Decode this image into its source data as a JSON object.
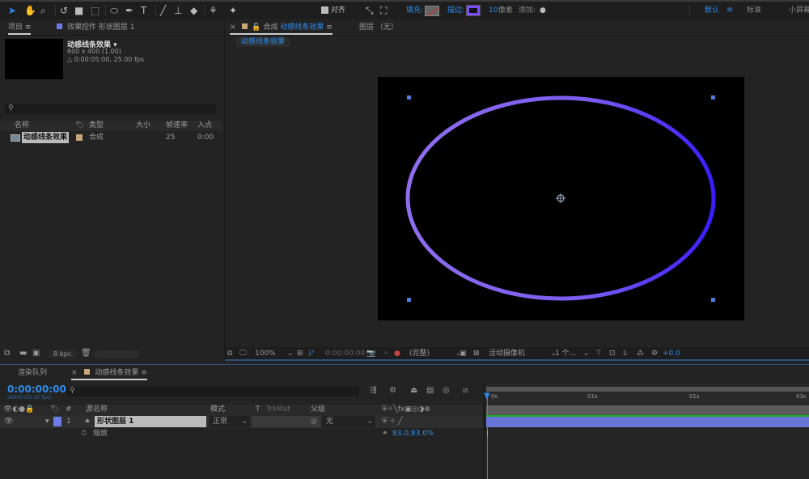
{
  "toolbar": {
    "tools": [
      "selection-tool",
      "hand-tool",
      "zoom-tool",
      "rotate-tool",
      "camera-tool",
      "pan-behind-tool",
      "ellipse-tool",
      "pen-tool",
      "type-tool",
      "brush-tool",
      "clone-stamp-tool",
      "eraser-tool",
      "roto-brush-tool",
      "puppet-tool"
    ],
    "type_glyph": "T",
    "snap_label": "对齐",
    "fill_label": "填充:",
    "stroke_label": "描边:",
    "stroke_width": "10",
    "stroke_unit": "像素",
    "add_label": "添加:",
    "workspaces": [
      "默认",
      "标准",
      "小屏幕"
    ],
    "stroke_color": "#7b4dff",
    "annotation_arrow_color": "#8b0000"
  },
  "project_panel": {
    "tab_project": "项目",
    "tab_effects": "效果控件 形状图层 1",
    "comp_name": "动感线条效果 ▾",
    "comp_size": "600 x 400 (1.00)",
    "comp_duration": "△ 0:00:05:00, 25.00 fps",
    "columns": [
      "名称",
      "类型",
      "大小",
      "帧速率",
      "入点"
    ],
    "items": [
      {
        "name": "动感线条效果",
        "type": "合成",
        "fps": "25",
        "in": "0:00"
      }
    ],
    "bpc": "8 bpc"
  },
  "comp_panel": {
    "tab_prefix": "合成",
    "tab_name": "动感线条效果",
    "layer_tab": "图层 （无）",
    "breadcrumb": "动感线条效果",
    "zoom": "100%",
    "timecode": "0:00:00:00",
    "resolution": "(完整)",
    "camera": "活动摄像机",
    "views": "1 个...",
    "exposure": "+0.0"
  },
  "timeline": {
    "tab_render": "渲染队列",
    "tab_comp": "动感线条效果",
    "timecode": "0:00:00:00",
    "frame_info": "00000 (25.00 fps)",
    "columns": {
      "num": "#",
      "source": "源名称",
      "mode": "模式",
      "t": "T",
      "trkmat": "TrkMat",
      "parent": "父级"
    },
    "layer": {
      "index": "1",
      "name": "形状图层 1",
      "mode": "正常",
      "parent": "无"
    },
    "property": {
      "name": "缩放",
      "value": "83.0,83.0%"
    },
    "ruler": [
      "0s",
      "01s",
      "01s",
      "03s"
    ]
  }
}
